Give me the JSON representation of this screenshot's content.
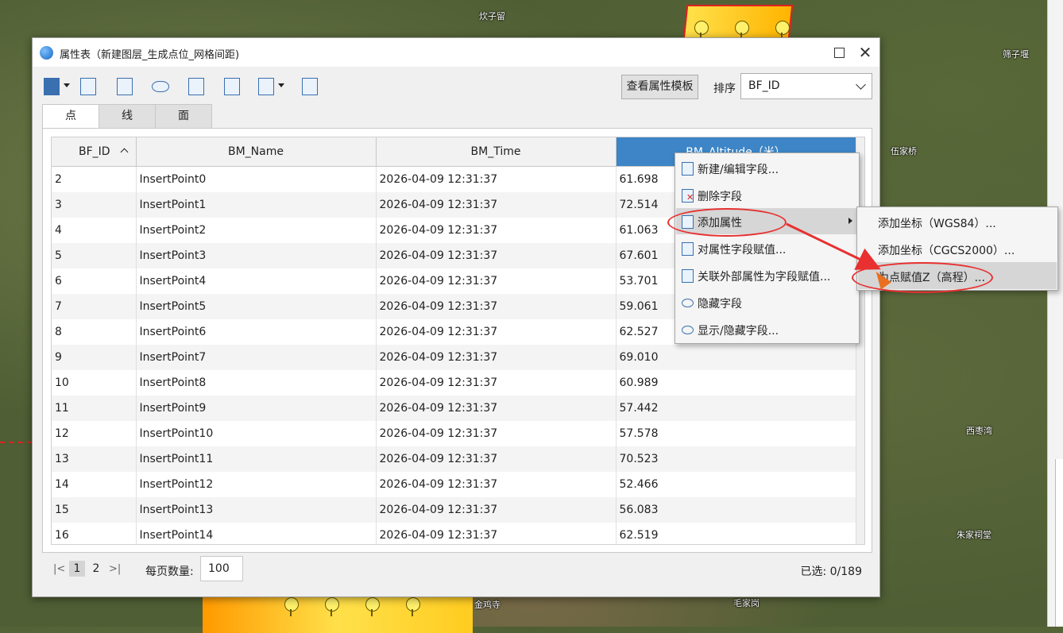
{
  "map": {
    "labels": [
      "炊子留",
      "筛子堰",
      "伍家桥",
      "西枣湾",
      "朱家祠堂",
      "毛家岗",
      "金鸡寺"
    ]
  },
  "window": {
    "title": "属性表（新建图层_生成点位_网格间距)",
    "toolbar": {
      "icons": [
        "save-icon",
        "query-icon",
        "edit-field-icon",
        "hide-icon",
        "export-icon",
        "select-icon",
        "list-icon",
        "layers-icon"
      ],
      "template_button": "查看属性模板",
      "sort_label": "排序",
      "sort_value": "BF_ID"
    },
    "tabs": [
      "点",
      "线",
      "面"
    ],
    "active_tab": 0
  },
  "table": {
    "columns": [
      "BF_ID",
      "BM_Name",
      "BM_Time",
      "BM_Altitude（米）"
    ],
    "rows": [
      [
        "2",
        "InsertPoint0",
        "2026-04-09 12:31:37",
        "61.698"
      ],
      [
        "3",
        "InsertPoint1",
        "2026-04-09 12:31:37",
        "72.514"
      ],
      [
        "4",
        "InsertPoint2",
        "2026-04-09 12:31:37",
        "61.063"
      ],
      [
        "5",
        "InsertPoint3",
        "2026-04-09 12:31:37",
        "67.601"
      ],
      [
        "6",
        "InsertPoint4",
        "2026-04-09 12:31:37",
        "53.701"
      ],
      [
        "7",
        "InsertPoint5",
        "2026-04-09 12:31:37",
        "59.061"
      ],
      [
        "8",
        "InsertPoint6",
        "2026-04-09 12:31:37",
        "62.527"
      ],
      [
        "9",
        "InsertPoint7",
        "2026-04-09 12:31:37",
        "69.010"
      ],
      [
        "10",
        "InsertPoint8",
        "2026-04-09 12:31:37",
        "60.989"
      ],
      [
        "11",
        "InsertPoint9",
        "2026-04-09 12:31:37",
        "57.442"
      ],
      [
        "12",
        "InsertPoint10",
        "2026-04-09 12:31:37",
        "57.578"
      ],
      [
        "13",
        "InsertPoint11",
        "2026-04-09 12:31:37",
        "70.523"
      ],
      [
        "14",
        "InsertPoint12",
        "2026-04-09 12:31:37",
        "52.466"
      ],
      [
        "15",
        "InsertPoint13",
        "2026-04-09 12:31:37",
        "56.083"
      ],
      [
        "16",
        "InsertPoint14",
        "2026-04-09 12:31:37",
        "62.519"
      ]
    ]
  },
  "pager": {
    "first": "|<",
    "pages": [
      "1",
      "2"
    ],
    "current": "1",
    "last": ">|",
    "per_page_label": "每页数量:",
    "per_page_value": "100",
    "selected": "已选: 0/189"
  },
  "context_menu": {
    "items": [
      {
        "label": "新建/编辑字段...",
        "icon": "edit-field-icon"
      },
      {
        "label": "删除字段",
        "icon": "delete-field-icon"
      },
      {
        "label": "添加属性",
        "icon": "add-attribute-icon",
        "submenu": true
      },
      {
        "label": "对属性字段赋值...",
        "icon": "assign-field-icon"
      },
      {
        "label": "关联外部属性为字段赋值...",
        "icon": "link-external-icon"
      },
      {
        "label": "隐藏字段",
        "icon": "hide-field-icon"
      },
      {
        "label": "显示/隐藏字段...",
        "icon": "show-hide-field-icon"
      }
    ]
  },
  "submenu": {
    "items": [
      "添加坐标（WGS84）...",
      "添加坐标（CGCS2000）...",
      "为点赋值Z（高程）..."
    ]
  },
  "colors": {
    "header_selected": "#3d85c6",
    "annotation": "#e83030",
    "menu_hover": "#d6d6d6"
  }
}
